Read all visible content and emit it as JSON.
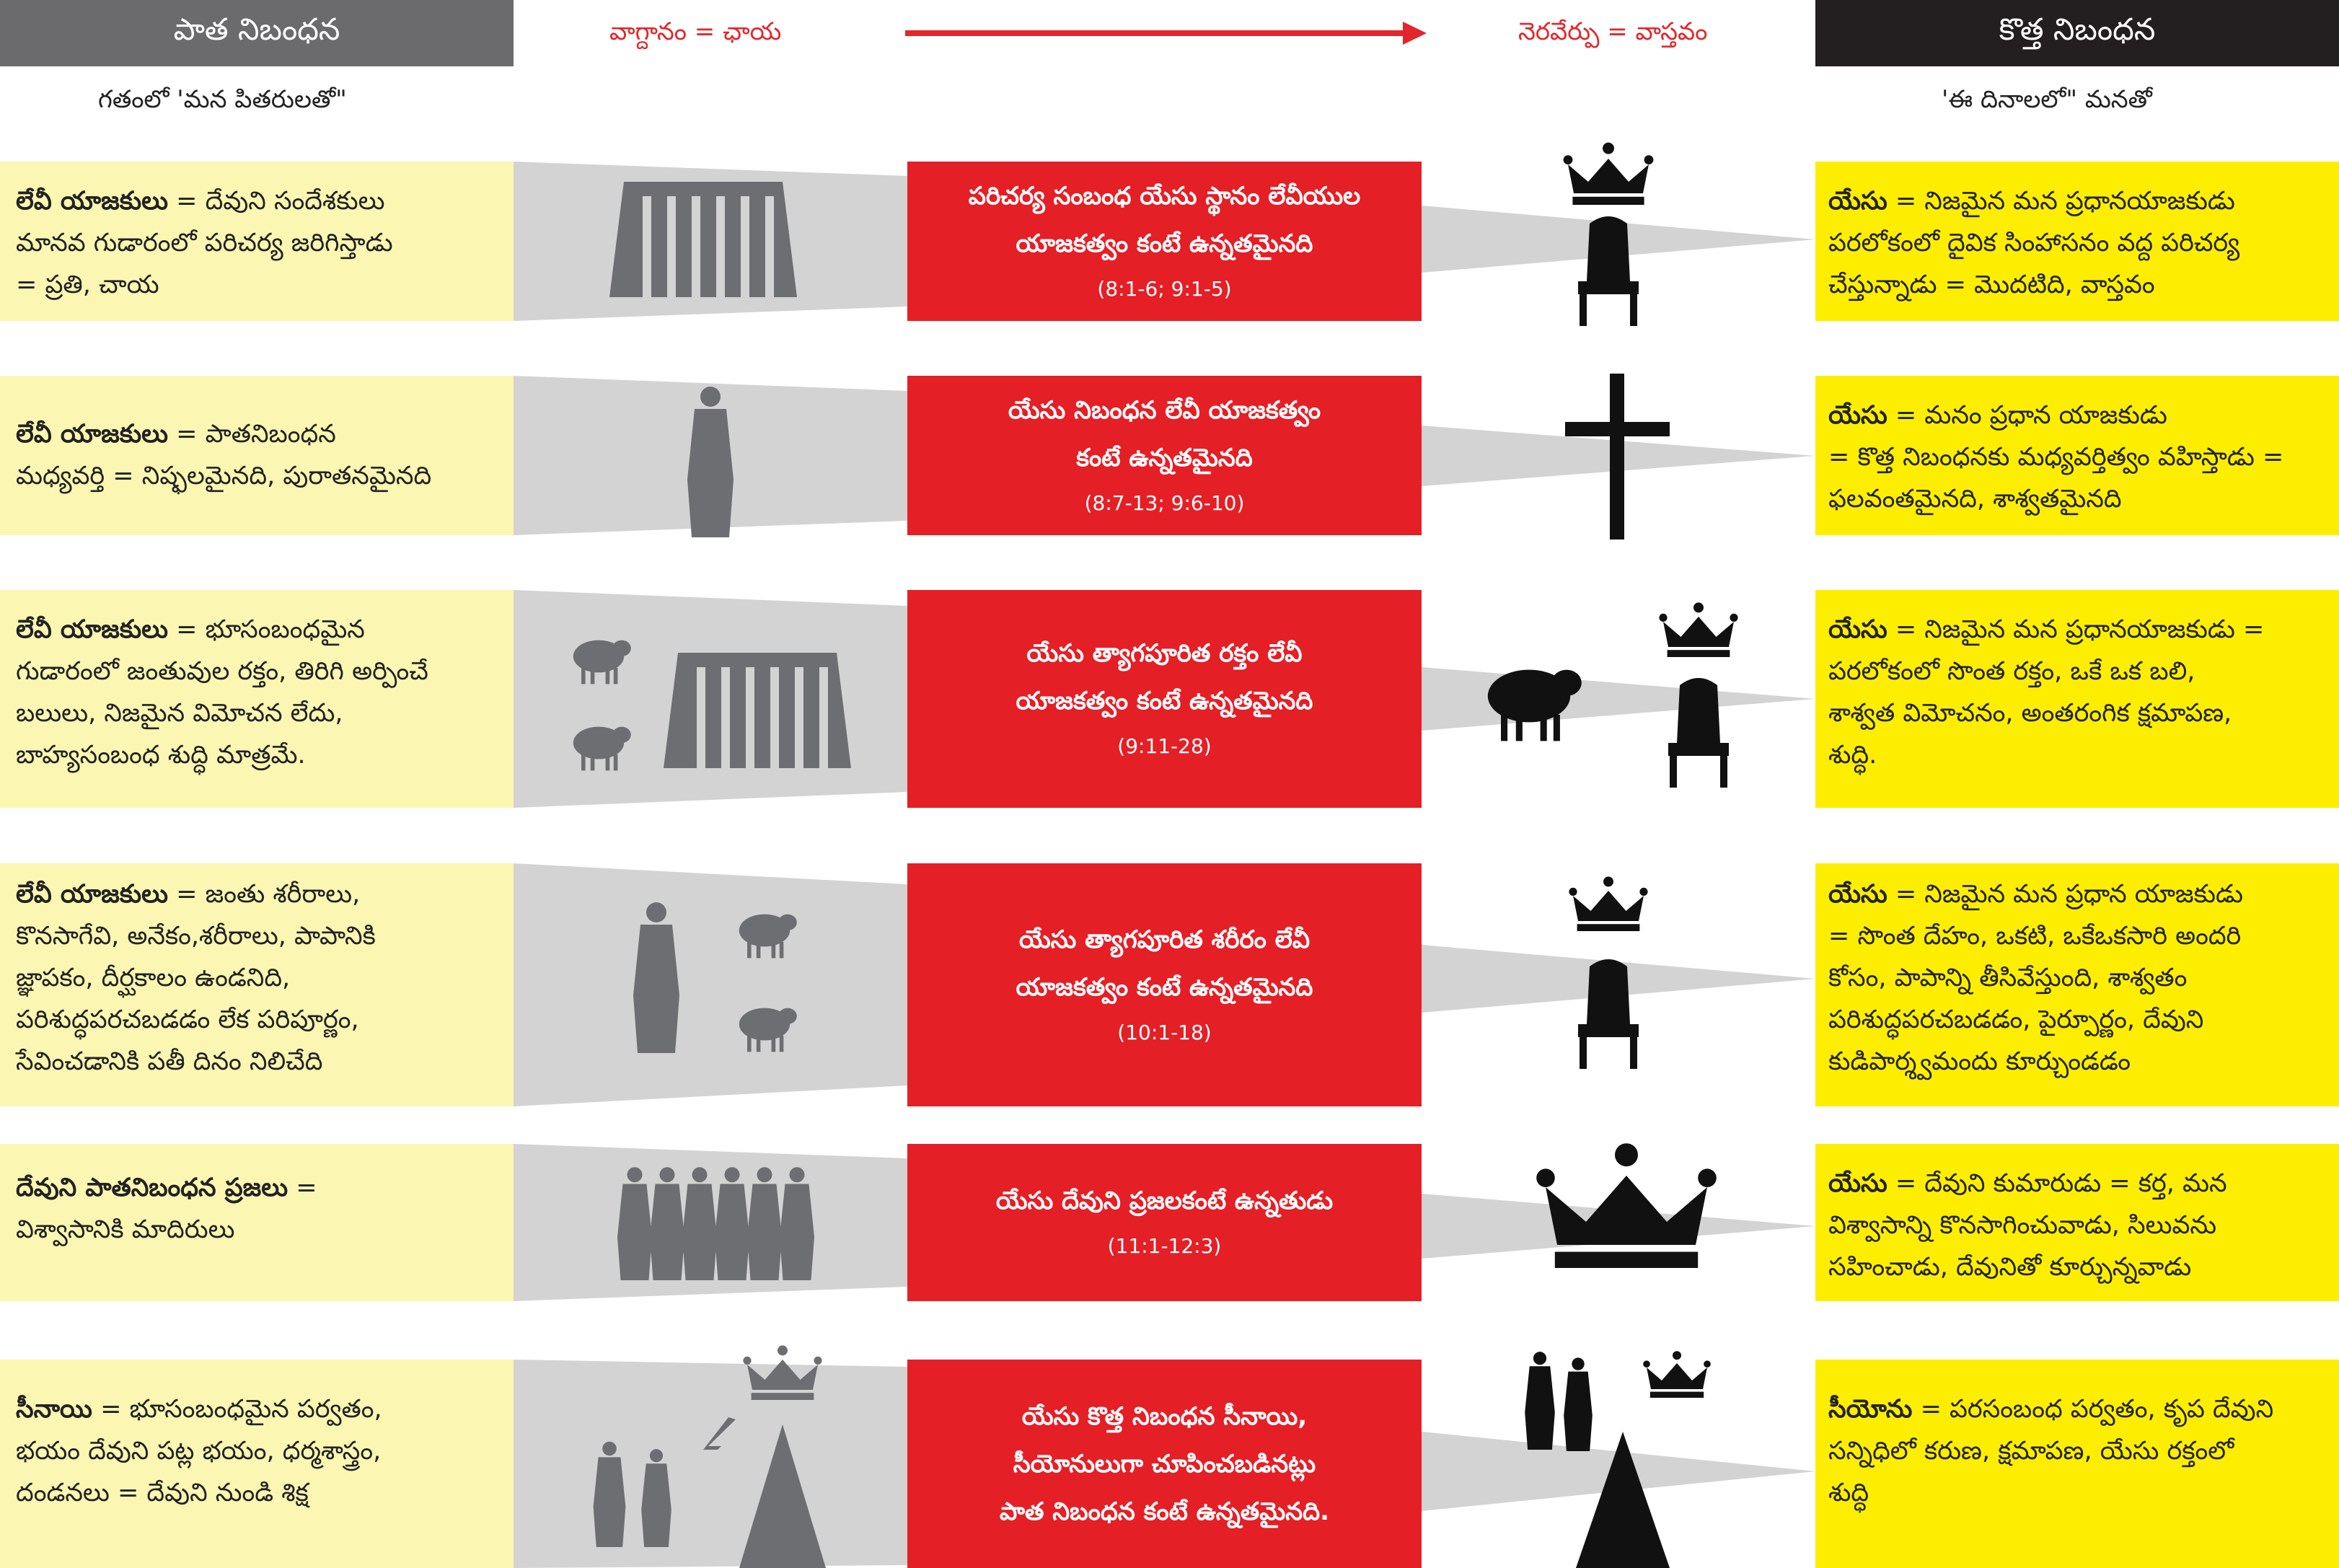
{
  "header": {
    "left_title": "పాత నిబంధన",
    "promise_label": "వాగ్దానం = ఛాయ",
    "fulfil_label": "నెరవేర్పు = వాస్తవం",
    "right_title": "కొత్త నిబంధన",
    "left_sub": "గతంలో 'మన పితరులతో\"",
    "right_sub": "'ఈ దినాలలో\" మనతో"
  },
  "colors": {
    "left_bg": "#fbf6b1",
    "right_bg": "#fdee00",
    "mid_bg": "#e51f26",
    "header_left": "#6b6b6d",
    "header_right": "#231f20",
    "arrow": "#e3262b"
  },
  "rows": [
    {
      "left_bold": "లేవీ యాజకులు",
      "left_lines": [
        "= దేవుని సందేశకులు",
        "మానవ గుడారంలో పరిచర్య జరిగిస్తాడు",
        "= ప్రతి,   చాయ"
      ],
      "mid_lines": [
        "పరిచర్య సంబంధ యేసు స్థానం లేవీయుల",
        "యాజకత్వం కంటే ఉన్నతమైనది"
      ],
      "mid_ref": "(8:1-6;  9:1-5)",
      "right_bold": "యేసు",
      "right_lines": [
        "= నిజమైన మన ప్రధానయాజకుడు",
        "పరలోకంలో దైవిక సింహాసనం వద్ద పరిచర్య",
        "చేస్తున్నాడు = మొదటిది, వాస్తవం"
      ],
      "left_icons": [
        "tabernacle-icon"
      ],
      "right_icons": [
        "crown-icon",
        "throne-icon"
      ]
    },
    {
      "left_bold": "లేవీ యాజకులు",
      "left_lines": [
        "= పాతనిబంధన",
        "మధ్యవర్తి = నిష్ఫలమైనది, పురాతనమైనది"
      ],
      "mid_lines": [
        "యేసు నిబంధన లేవీ యాజకత్వం",
        "కంటే ఉన్నతమైనది"
      ],
      "mid_ref": "(8:7-13;  9:6-10)",
      "right_bold": "యేసు",
      "right_lines": [
        "= మనం ప్రధాన యాజకుడు",
        "= కొత్త నిబంధనకు మధ్యవర్తిత్వం వహిస్తాడు =",
        "ఫలవంతమైనది, శాశ్వతమైనది"
      ],
      "left_icons": [
        "priest-icon"
      ],
      "right_icons": [
        "cross-icon"
      ]
    },
    {
      "left_bold": "లేవీ యాజకులు",
      "left_lines": [
        "= భూసంబంధమైన",
        "గుడారంలో జంతువుల రక్తం, తిరిగి అర్పించే",
        "బలులు, నిజమైన విమోచన లేదు,",
        "బాహ్యసంబంధ శుద్ధి మాత్రమే."
      ],
      "mid_lines": [
        "యేసు త్యాగపూరిత రక్తం లేవీ",
        "యాజకత్వం కంటే ఉన్నతమైనది"
      ],
      "mid_ref": "(9:11-28)",
      "right_bold": "యేసు",
      "right_lines": [
        "= నిజమైన మన ప్రధానయాజకుడు =",
        "పరలోకంలో సొంత రక్తం, ఒకే ఒక బలి,",
        "శాశ్వత విమోచనం, అంతరంగిక క్షమాపణ,",
        "శుద్ధి."
      ],
      "left_icons": [
        "sheep-icon",
        "sheep-icon",
        "tabernacle-icon"
      ],
      "right_icons": [
        "lamb-icon",
        "crown-icon",
        "throne-icon"
      ]
    },
    {
      "left_bold": "లేవీ యాజకులు",
      "left_lines": [
        "= జంతు శరీరాలు,",
        "కొనసాగేవి, అనేకం,శరీరాలు, పాపానికి",
        "జ్ఞాపకం, దీర్ఘకాలం ఉండనిది,",
        "పరిశుద్ధపరచబడడం లేక పరిపూర్ణం,",
        "సేవించడానికి పతీ దినం నిలిచేది"
      ],
      "mid_lines": [
        "యేసు త్యాగపూరిత శరీరం లేవీ",
        "యాజకత్వం కంటే ఉన్నతమైనది"
      ],
      "mid_ref": "(10:1-18)",
      "right_bold": "యేసు",
      "right_lines": [
        "= నిజమైన మన ప్రధాన యాజకుడు",
        "= సొంత దేహం, ఒకటి, ఒకేఒకసారి అందరి",
        "కోసం, పాపాన్ని తీసివేస్తుంది, శాశ్వతం",
        "పరిశుద్ధపరచబడడం, పైర్పూర్ణం, దేవుని",
        "కుడిపార్శ్వమందు కూర్చుండడం"
      ],
      "left_icons": [
        "priest-icon",
        "sheep-icon",
        "sheep-icon"
      ],
      "right_icons": [
        "crown-icon",
        "throne-icon"
      ]
    },
    {
      "left_bold": "దేవుని పాతనిబంధన ప్రజలు",
      "left_lines": [
        "=",
        "విశ్వాసానికి మాదిరులు"
      ],
      "mid_lines": [
        "యేసు దేవుని ప్రజలకంటే ఉన్నతుడు"
      ],
      "mid_ref": "(11:1-12:3)",
      "right_bold": "యేసు",
      "right_lines": [
        "= దేవుని కుమారుడు = కర్త, మన",
        "విశ్వాసాన్ని కొనసాగించువాడు, సిలువను",
        "సహించాడు, దేవునితో కూర్చున్నవాడు"
      ],
      "left_icons": [
        "people-group-icon"
      ],
      "right_icons": [
        "crown-icon"
      ]
    },
    {
      "left_bold": "సీనాయి",
      "left_lines": [
        "= భూసంబంధమైన పర్వతం,",
        "భయం దేవుని పట్ల భయం, ధర్మశాస్త్రం,",
        "దండనలు = దేవుని నుండి శిక్ష"
      ],
      "mid_lines": [
        "యేసు కొత్త నిబంధన సీనాయి,",
        "సీయోనులుగా చూపించబడినట్లు",
        "పాత నిబంధన కంటే ఉన్నతమైనది."
      ],
      "mid_ref": "",
      "right_bold": "సీయోను",
      "right_lines": [
        "= పరసంబంధ పర్వతం, కృప దేవుని",
        "సన్నిధిలో కరుణ, క్షమాపణ, యేసు రక్తంలో",
        "శుద్ధి"
      ],
      "left_icons": [
        "people-icon",
        "lightning-icon",
        "crown-icon",
        "mountain-icon"
      ],
      "right_icons": [
        "people-icon",
        "crown-icon",
        "mountain-icon"
      ]
    }
  ]
}
